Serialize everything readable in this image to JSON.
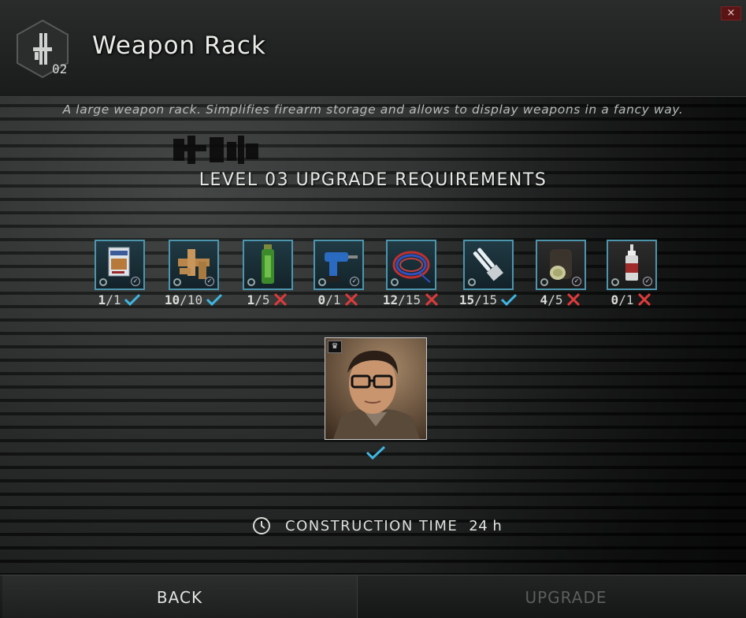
{
  "header": {
    "title": "Weapon Rack",
    "level_badge": "02",
    "icon": "rifle-icon",
    "close_label": "×"
  },
  "description": "A large weapon rack. Simplifies firearm storage and allows to display weapons in a fancy way.",
  "upgrade_title": "LEVEL 03 UPGRADE REQUIREMENTS",
  "requirements": [
    {
      "icon": "magazine-icon",
      "have": "1",
      "need": "/1",
      "status": "ok"
    },
    {
      "icon": "pipe-fittings-icon",
      "have": "10",
      "need": "/10",
      "status": "ok"
    },
    {
      "icon": "green-bottle-icon",
      "have": "1",
      "need": "/5",
      "status": "missing"
    },
    {
      "icon": "power-drill-icon",
      "have": "0",
      "need": "/1",
      "status": "missing"
    },
    {
      "icon": "wires-icon",
      "have": "12",
      "need": "/15",
      "status": "missing"
    },
    {
      "icon": "light-bulb-icon",
      "have": "15",
      "need": "/15",
      "status": "ok"
    },
    {
      "icon": "filter-cylinder-icon",
      "have": "4",
      "need": "/5",
      "status": "missing"
    },
    {
      "icon": "oil-bottle-icon",
      "have": "0",
      "need": "/1",
      "status": "missing"
    }
  ],
  "trader": {
    "name_icon": "trader-portrait-icon",
    "crown": "♛",
    "status": "ok"
  },
  "construction": {
    "label": "CONSTRUCTION TIME",
    "value": "24 h"
  },
  "footer": {
    "back_label": "BACK",
    "upgrade_label": "UPGRADE"
  },
  "colors": {
    "ok": "#3fb6e0",
    "missing": "#e03a3a",
    "slot_border": "#4d95ad"
  }
}
